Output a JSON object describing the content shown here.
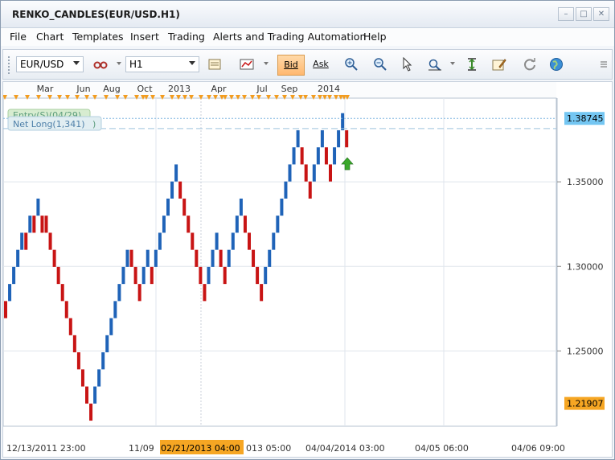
{
  "window": {
    "title": "RENKO_CANDLES(EUR/USD.H1)"
  },
  "window_controls": {
    "minimize": "–",
    "maximize": "□",
    "close": "✕"
  },
  "menu": [
    {
      "label": "File"
    },
    {
      "label": "Chart"
    },
    {
      "label": "Templates"
    },
    {
      "label": "Insert"
    },
    {
      "label": "Trading"
    },
    {
      "label": "Alerts and Trading Automation"
    },
    {
      "label": "Help"
    }
  ],
  "toolbar": {
    "symbol": "EUR/USD",
    "timeframe": "H1",
    "bid_label": "Bid",
    "ask_label": "Ask"
  },
  "chart_data": {
    "type": "renko",
    "top_axis_labels": [
      "Mar",
      "Jun",
      "Aug",
      "Oct",
      "2013",
      "Apr",
      "Jul",
      "Sep",
      "2014"
    ],
    "bottom_axis_labels": [
      "12/13/2011 23:00",
      "11/09",
      "02/21/2013 04:00",
      "013 05:00",
      "04/04/2014 03:00",
      "04/05 06:00",
      "04/06 09:00"
    ],
    "y_ticks": [
      1.25,
      1.3,
      1.35
    ],
    "y_tick_labels": [
      "1.25000",
      "1.30000",
      "1.35000"
    ],
    "ylim": [
      1.2055,
      1.3995
    ],
    "current_price_label": "1.38745",
    "low_price_label": "1.21907",
    "crosshair_date_label": "02/21/2013 04:00",
    "order_labels": {
      "entry": "Entry(S)(04/29)",
      "net_long": "Net Long(1,341)",
      "net_long_close": ")"
    },
    "colors": {
      "up": "#1f63b8",
      "down": "#c81414",
      "price_tag_bg": "#74c6f2",
      "low_tag_bg": "#f6a623",
      "date_tag_bg": "#f6a623",
      "signal_arrow": "#3aa82a"
    },
    "brick_size": 0.0101,
    "brick_tops": [
      1.2795,
      1.2896,
      1.2997,
      1.3098,
      1.3199,
      1.3199,
      1.33,
      1.33,
      1.3401,
      1.33,
      1.33,
      1.3199,
      1.3098,
      1.2997,
      1.2896,
      1.2795,
      1.2694,
      1.2593,
      1.2492,
      1.2391,
      1.229,
      1.2189,
      1.229,
      1.2391,
      1.2492,
      1.2593,
      1.2694,
      1.2795,
      1.2896,
      1.2997,
      1.3098,
      1.3098,
      1.2997,
      1.2896,
      1.2997,
      1.3098,
      1.2997,
      1.3098,
      1.3199,
      1.33,
      1.3401,
      1.3502,
      1.3603,
      1.3502,
      1.3401,
      1.33,
      1.3199,
      1.3098,
      1.2997,
      1.2896,
      1.2997,
      1.3098,
      1.3199,
      1.3098,
      1.2997,
      1.3098,
      1.3199,
      1.33,
      1.3401,
      1.33,
      1.3199,
      1.3098,
      1.2997,
      1.2896,
      1.2997,
      1.3098,
      1.3199,
      1.33,
      1.3401,
      1.3502,
      1.3603,
      1.3704,
      1.3805,
      1.3704,
      1.3603,
      1.3502,
      1.3603,
      1.3704,
      1.3805,
      1.3704,
      1.3603,
      1.3704,
      1.3805,
      1.3906,
      1.3805
    ],
    "brick_dirs": [
      "down",
      "up",
      "up",
      "up",
      "up",
      "down",
      "up",
      "down",
      "up",
      "down",
      "down",
      "down",
      "down",
      "down",
      "down",
      "down",
      "down",
      "down",
      "down",
      "down",
      "down",
      "down",
      "up",
      "up",
      "up",
      "up",
      "up",
      "up",
      "up",
      "up",
      "up",
      "down",
      "down",
      "down",
      "up",
      "up",
      "down",
      "up",
      "up",
      "up",
      "up",
      "up",
      "up",
      "down",
      "down",
      "down",
      "down",
      "down",
      "down",
      "down",
      "up",
      "up",
      "up",
      "down",
      "down",
      "up",
      "up",
      "up",
      "up",
      "down",
      "down",
      "down",
      "down",
      "down",
      "up",
      "up",
      "up",
      "up",
      "up",
      "up",
      "up",
      "up",
      "up",
      "down",
      "down",
      "down",
      "up",
      "up",
      "up",
      "down",
      "down",
      "up",
      "up",
      "up",
      "down"
    ]
  }
}
